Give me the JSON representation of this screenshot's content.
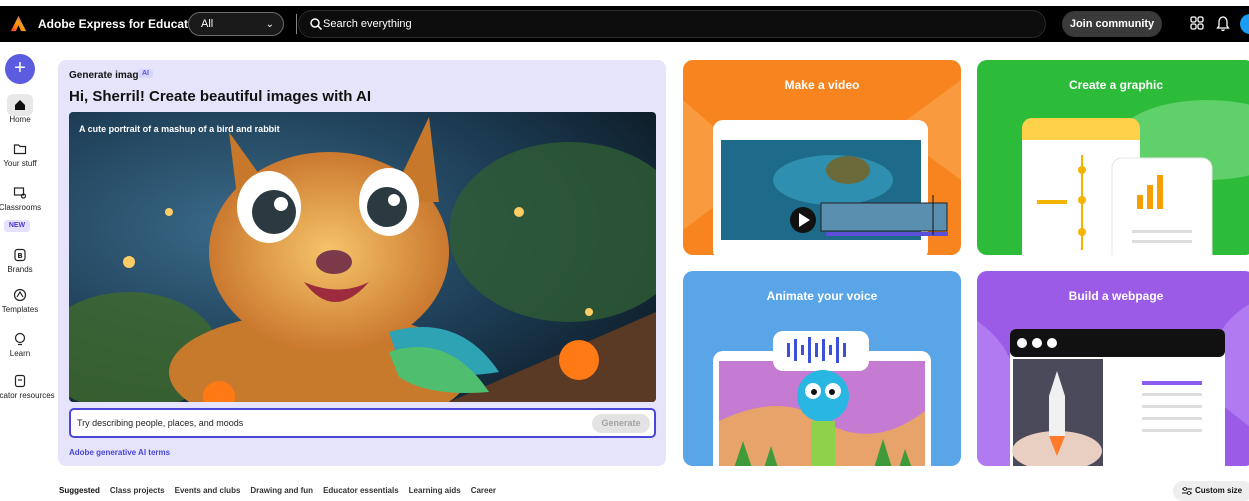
{
  "header": {
    "app_title": "Adobe Express for Education",
    "filter_value": "All",
    "search_placeholder": "Search everything",
    "join_label": "Join community"
  },
  "rail": {
    "create_label": "+",
    "items": [
      {
        "label": "Home",
        "icon": "home-icon"
      },
      {
        "label": "Your stuff",
        "icon": "folder-icon"
      },
      {
        "label": "Classrooms",
        "icon": "classroom-icon"
      },
      {
        "label": "Brands",
        "icon": "brand-icon"
      },
      {
        "label": "Templates",
        "icon": "templates-icon"
      },
      {
        "label": "Learn",
        "icon": "learn-icon"
      },
      {
        "label": "Educator resources",
        "icon": "educator-icon"
      }
    ],
    "new_badge": "NEW"
  },
  "generate": {
    "label": "Generate image",
    "ai_badge": "AI",
    "heading": "Hi, Sherril! Create beautiful images with AI",
    "image_caption": "A cute portrait of a mashup of a bird and rabbit",
    "prompt_placeholder": "Try describing people, places, and moods",
    "generate_label": "Generate",
    "terms_link": "Adobe generative AI terms"
  },
  "tiles": [
    {
      "title": "Make a video",
      "color": "#f7841e"
    },
    {
      "title": "Create a graphic",
      "color": "#2dbb3a"
    },
    {
      "title": "Animate your voice",
      "color": "#5aa4e8"
    },
    {
      "title": "Build a webpage",
      "color": "#9b5be6"
    }
  ],
  "tabs": [
    "Suggested",
    "Class projects",
    "Events and clubs",
    "Drawing and fun",
    "Educator essentials",
    "Learning aids",
    "Career"
  ],
  "custom_size_label": "Custom size",
  "colors": {
    "accent": "#4a46d8",
    "topbar": "#000000",
    "panel": "#e6e4fb"
  }
}
